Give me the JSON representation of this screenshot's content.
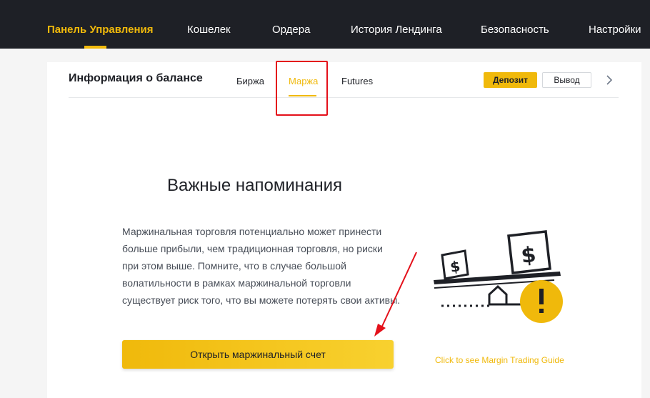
{
  "nav": {
    "items": [
      {
        "label": "Панель Управления",
        "active": true
      },
      {
        "label": "Кошелек"
      },
      {
        "label": "Ордера"
      },
      {
        "label": "История Лендинга"
      },
      {
        "label": "Безопасность"
      },
      {
        "label": "Настройки"
      }
    ]
  },
  "balance": {
    "title": "Информация о балансе",
    "tabs": [
      {
        "label": "Биржа"
      },
      {
        "label": "Маржа",
        "active": true
      },
      {
        "label": "Futures"
      }
    ],
    "deposit_label": "Депозит",
    "withdraw_label": "Вывод"
  },
  "reminder": {
    "title": "Важные напоминания",
    "text": "Маржинальная торговля потенциально может принести больше прибыли, чем традиционная торговля, но риски при этом выше. Помните, что в случае большой волатильности в рамках маржинальной торговли существует риск того, что вы можете потерять свои активы.",
    "button_label": "Открыть маржинальный счет",
    "guide_link": "Click to see Margin Trading Guide"
  },
  "colors": {
    "accent": "#f0b90b",
    "nav_bg": "#1e2026",
    "annotation_red": "#e4101a"
  },
  "icons": {
    "chevron": "chevron-right-icon",
    "illustration": "scale-dollar-warning-illustration",
    "arrow": "red-arrow-annotation"
  }
}
